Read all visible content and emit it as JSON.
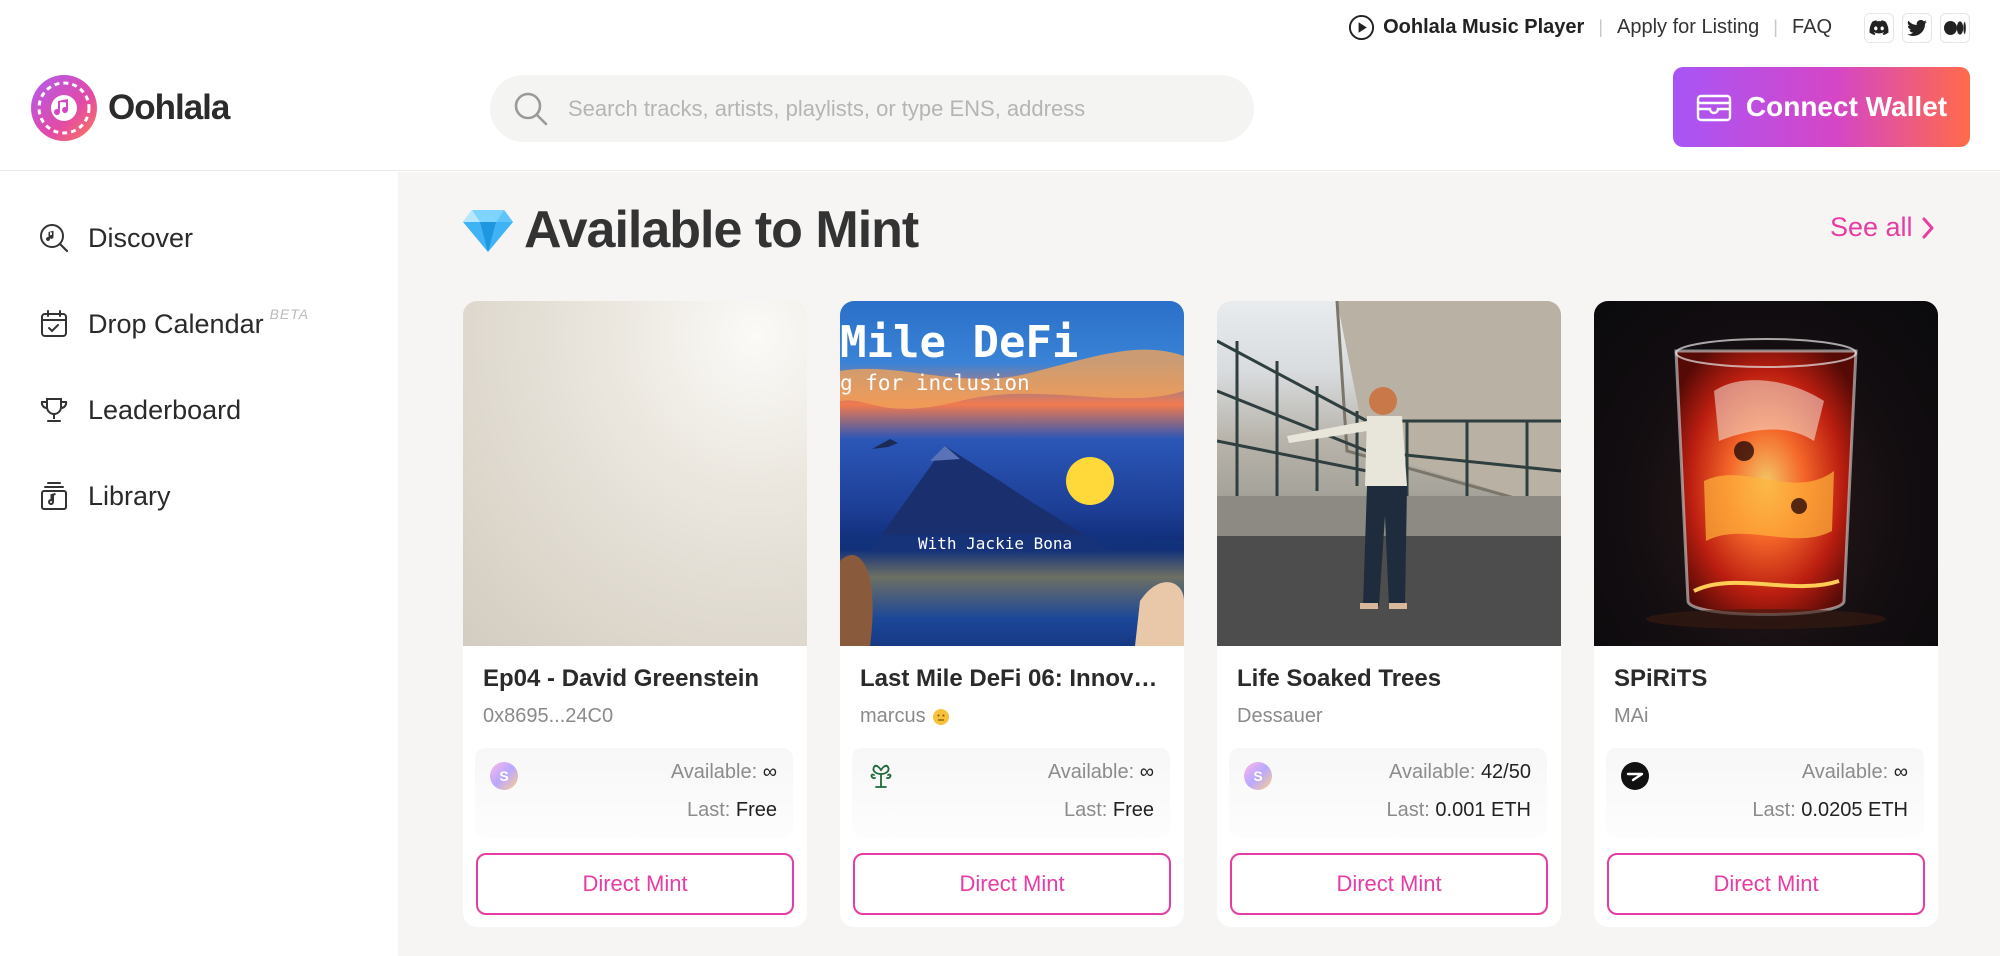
{
  "utility": {
    "player_label": "Oohlala Music Player",
    "apply_label": "Apply for Listing",
    "faq_label": "FAQ",
    "separator": "|",
    "socials": [
      "discord-icon",
      "twitter-icon",
      "medium-icon"
    ]
  },
  "header": {
    "brand": "Oohlala",
    "search_placeholder": "Search tracks, artists, playlists, or type ENS, address",
    "connect_label": "Connect Wallet"
  },
  "sidebar": {
    "items": [
      {
        "label": "Discover",
        "icon": "music-search-icon"
      },
      {
        "label": "Drop Calendar",
        "icon": "calendar-icon",
        "badge": "BETA"
      },
      {
        "label": "Leaderboard",
        "icon": "trophy-icon"
      },
      {
        "label": "Library",
        "icon": "library-icon"
      }
    ]
  },
  "main": {
    "section_title": "Available to Mint",
    "see_all": "See all",
    "available_label": "Available:",
    "last_label": "Last:",
    "mint_label": "Direct Mint",
    "cards": [
      {
        "title": "Ep04 - David Greenstein",
        "artist": "0x8695...24C0",
        "platform": "sound-icon",
        "available": "∞",
        "last": "Free"
      },
      {
        "title": "Last Mile DeFi 06: Innovat...",
        "artist": "marcus",
        "platform": "tree-icon",
        "available": "∞",
        "last": "Free",
        "art_text1": "Mile DeFi",
        "art_text2": "g for inclusion",
        "art_text3": "With Jackie Bona"
      },
      {
        "title": "Life Soaked Trees",
        "artist": "Dessauer",
        "platform": "sound-icon",
        "available": "42/50",
        "last": "0.001 ETH"
      },
      {
        "title": "SPiRiTS",
        "artist": "MAi",
        "platform": "zora-icon",
        "available": "∞",
        "last": "0.0205 ETH"
      }
    ]
  },
  "colors": {
    "accent": "#e63ca3",
    "wallet_gradient_start": "#a855f7",
    "wallet_gradient_end": "#ff6b4a",
    "main_bg": "#f6f5f3"
  }
}
